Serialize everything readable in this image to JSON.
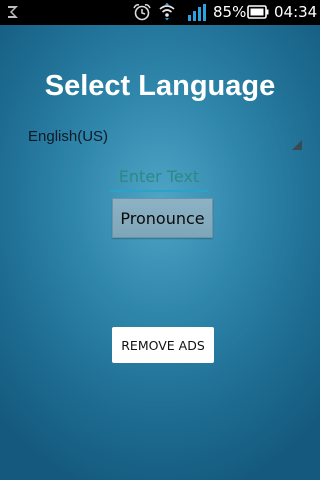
{
  "status_bar": {
    "battery_percent": "85%",
    "time": "04:34",
    "icons": [
      "notification-icon",
      "alarm-icon",
      "wifi-icon",
      "signal-icon",
      "battery-icon"
    ]
  },
  "title": "Select Language",
  "language_select": {
    "selected": "English(US)"
  },
  "text_input": {
    "placeholder": "Enter Text",
    "value": ""
  },
  "pronounce_button": {
    "label": "Pronounce"
  },
  "remove_ads_button": {
    "label": "REMOVE ADS"
  },
  "colors": {
    "background": "#2f86ab",
    "title": "#ffffff",
    "input_underline": "#2aa3c8",
    "placeholder": "#2a8a84",
    "pronounce_button": "#84abbe",
    "remove_ads_button": "#ffffff"
  }
}
